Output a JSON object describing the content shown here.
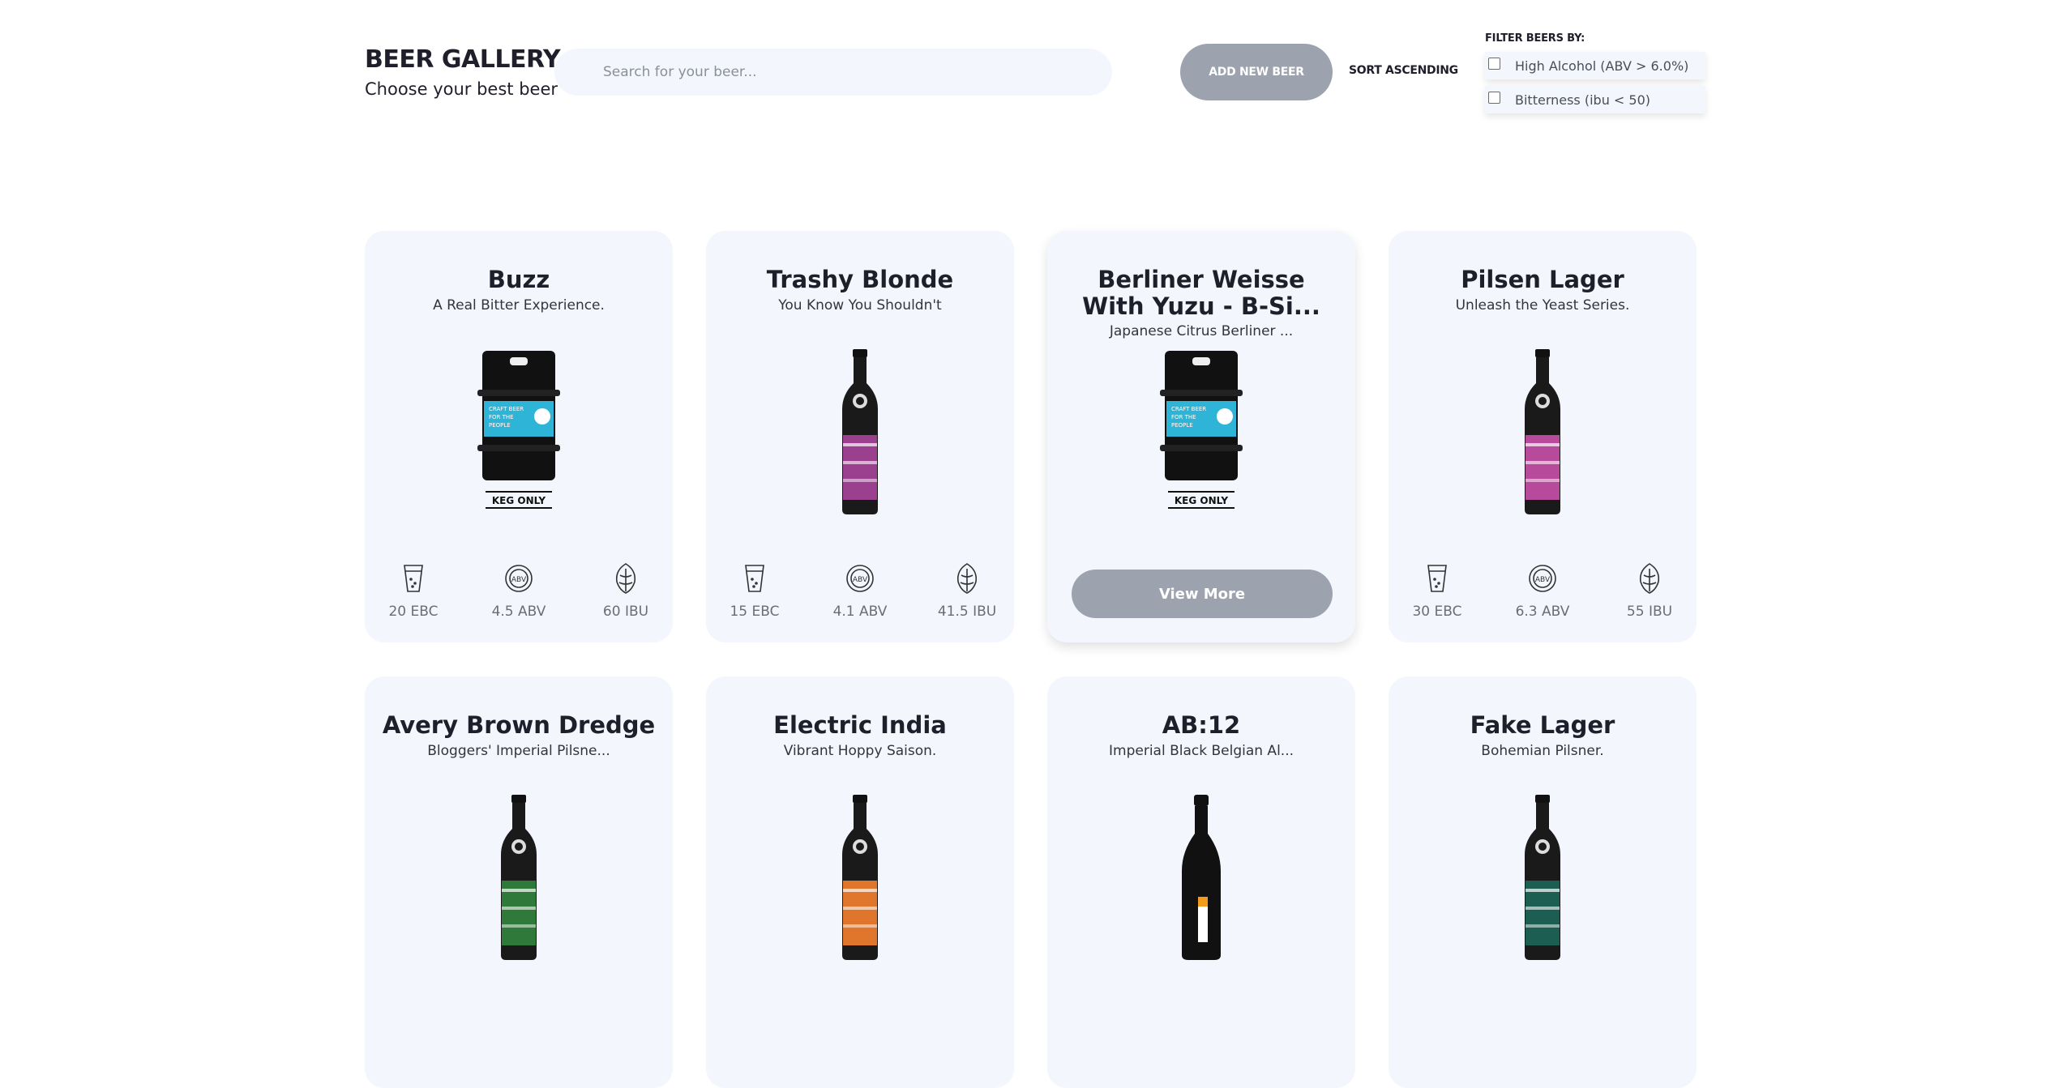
{
  "header": {
    "title": "BEER GALLERY",
    "subtitle": "Choose your best beer",
    "search_placeholder": "Search for your beer...",
    "add_button": "ADD NEW BEER",
    "sort_button": "SORT ASCENDING",
    "filter_title": "FILTER BEERS BY:",
    "filters": [
      {
        "label": "High Alcohol (ABV > 6.0%)",
        "checked": false
      },
      {
        "label": "Bitterness (ibu < 50)",
        "checked": false
      }
    ]
  },
  "view_more_label": "View More",
  "beers": [
    {
      "name": "Buzz",
      "tagline": "A Real Bitter Experience.",
      "image": "keg",
      "ebc": "20 EBC",
      "abv": "4.5 ABV",
      "ibu": "60 IBU"
    },
    {
      "name": "Trashy Blonde",
      "tagline": "You Know You Shouldn't",
      "image": "bottle-purple",
      "ebc": "15 EBC",
      "abv": "4.1 ABV",
      "ibu": "41.5 IBU"
    },
    {
      "name": "Berliner Weisse With Yuzu - B-Si...",
      "tagline": "Japanese Citrus Berliner ...",
      "image": "keg",
      "hovered": true
    },
    {
      "name": "Pilsen Lager",
      "tagline": "Unleash the Yeast Series.",
      "image": "bottle-pink",
      "ebc": "30 EBC",
      "abv": "6.3 ABV",
      "ibu": "55 IBU"
    },
    {
      "name": "Avery Brown Dredge",
      "tagline": "Bloggers' Imperial Pilsne...",
      "image": "bottle-green"
    },
    {
      "name": "Electric India",
      "tagline": "Vibrant Hoppy Saison.",
      "image": "bottle-orange"
    },
    {
      "name": "AB:12",
      "tagline": "Imperial Black Belgian Al...",
      "image": "bottle-black-large"
    },
    {
      "name": "Fake Lager",
      "tagline": "Bohemian Pilsner.",
      "image": "bottle-teal"
    }
  ],
  "colors": {
    "card_bg": "#f3f6fd",
    "button_grey": "#9ca2ae",
    "text_dark": "#1f1f2b",
    "muted_text": "#6a6d78"
  }
}
